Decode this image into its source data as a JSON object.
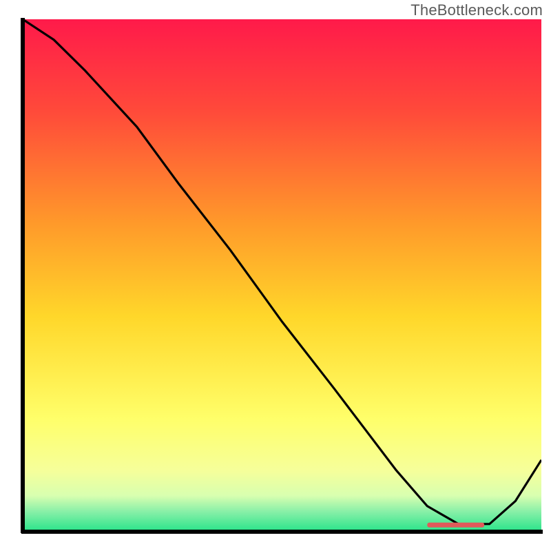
{
  "watermark": {
    "text": "TheBottleneck.com"
  },
  "chart_data": {
    "type": "line",
    "title": "",
    "xlabel": "",
    "ylabel": "",
    "xlim": [
      0,
      100
    ],
    "ylim": [
      0,
      100
    ],
    "grid": false,
    "legend": false,
    "background_gradient": {
      "top": "#ff1a4a",
      "mid_upper": "#ff8a2a",
      "mid": "#ffd72a",
      "mid_lower": "#ffff8a",
      "near_bottom": "#f4ffa0",
      "bottom": "#27e38a"
    },
    "series": [
      {
        "name": "bottleneck-curve",
        "x": [
          0,
          6,
          12,
          22,
          30,
          40,
          50,
          60,
          66,
          72,
          78,
          84,
          90,
          95,
          100
        ],
        "values": [
          100,
          96,
          90,
          79,
          68,
          55,
          41,
          28,
          20,
          12,
          5,
          1.5,
          1.5,
          6,
          14
        ],
        "color": "#000000"
      }
    ],
    "annotations": [
      {
        "name": "optimal-zone",
        "type": "segment",
        "x_start": 78,
        "x_end": 89,
        "y": 1.3,
        "color": "#e05a5a",
        "label": ""
      }
    ]
  }
}
